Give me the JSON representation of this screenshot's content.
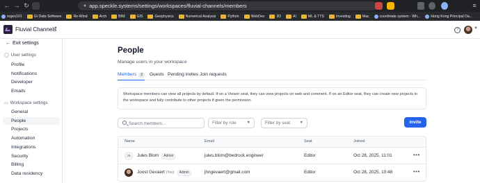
{
  "browser": {
    "url": "app.speckle.systems/settings/workspaces/fluvial-channels/members",
    "bookmarks": [
      {
        "label": "regex101",
        "type": "site"
      },
      {
        "label": "GI Data Software",
        "type": "folder"
      },
      {
        "label": "Re-Wind",
        "type": "folder"
      },
      {
        "label": "Arch",
        "type": "folder"
      },
      {
        "label": "BIM",
        "type": "folder"
      },
      {
        "label": "GIS",
        "type": "folder"
      },
      {
        "label": "Geophysics",
        "type": "folder"
      },
      {
        "label": "Numerical Analysis",
        "type": "folder"
      },
      {
        "label": "Python",
        "type": "folder"
      },
      {
        "label": "WebDev",
        "type": "folder"
      },
      {
        "label": "3D",
        "type": "folder"
      },
      {
        "label": "AI",
        "type": "folder"
      },
      {
        "label": "ML & TTS",
        "type": "folder"
      },
      {
        "label": "Investing",
        "type": "folder"
      },
      {
        "label": "Mac",
        "type": "folder"
      },
      {
        "label": "coordinate system - Wh...",
        "type": "site"
      },
      {
        "label": "Hong Kong Principal Da...",
        "type": "site"
      }
    ]
  },
  "header": {
    "workspace_name": "Fluvial Channels"
  },
  "sidebar": {
    "exit_label": "Exit settings",
    "user_section": "User settings",
    "user_items": [
      "Profile",
      "Notifications",
      "Developer",
      "Emails"
    ],
    "workspace_section": "Workspace settings",
    "workspace_items": [
      "General",
      "People",
      "Projects",
      "Automation",
      "Integrations",
      "Security",
      "Billing",
      "Data residency"
    ],
    "active_item": "People"
  },
  "main": {
    "title": "People",
    "subtitle": "Manage users in your workspace",
    "tabs": [
      {
        "label": "Members",
        "count": "2"
      },
      {
        "label": "Guests"
      },
      {
        "label": "Pending invites"
      },
      {
        "label": "Join requests"
      }
    ],
    "info_text": "Workspace members can view all projects by default. If on a Viewer seat, they can view projects on web and comment. If on an Editor seat, they can create new projects in the workspace and fully contribute to other projects if given the permission.",
    "search_placeholder": "Search members...",
    "filter_role": "Filter by role",
    "filter_seat": "Filter by seat",
    "invite_label": "Invite",
    "table": {
      "headers": [
        "Name",
        "Email",
        "Seat",
        "Joined"
      ],
      "rows": [
        {
          "initials": "JB",
          "name": "Jules Blom",
          "you": "",
          "badge": "Admin",
          "email": "jules.blom@bedrock.engineer",
          "seat": "Editor",
          "joined": "Oct 28, 2025, 11:01"
        },
        {
          "initials": "",
          "name": "Joost Gevaert",
          "you": "(You)",
          "badge": "Admin",
          "email": "jhngevaert@gmail.com",
          "seat": "Editor",
          "joined": "Oct 28, 2025, 10:48"
        }
      ]
    }
  },
  "colors": {
    "accent": "#2563eb",
    "chrome": "#202124",
    "workspace_logo": "#2b1e3f"
  }
}
